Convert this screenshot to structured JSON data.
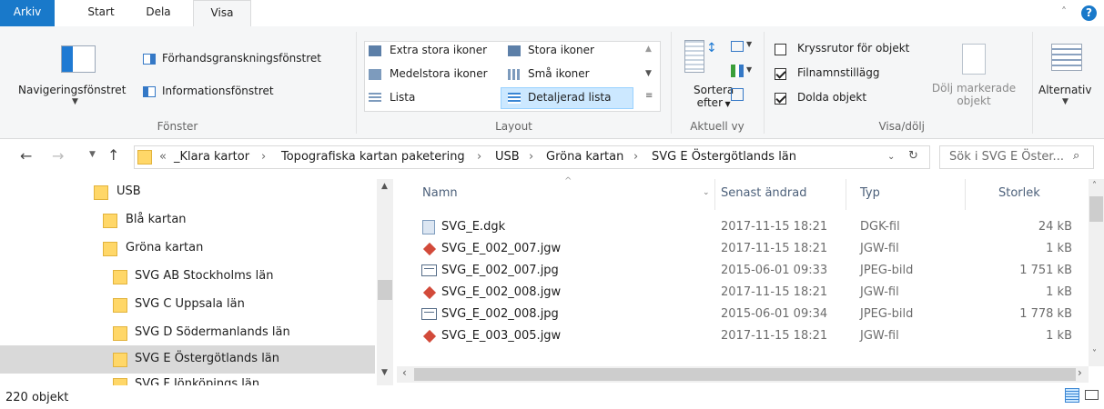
{
  "tabs": {
    "file": "Arkiv",
    "home": "Start",
    "share": "Dela",
    "view": "Visa"
  },
  "ribbon": {
    "panes": {
      "preview": "Förhandsgranskningsfönstret",
      "navigation": "Navigeringsfönstret",
      "details": "Informationsfönstret",
      "group": "Fönster"
    },
    "layout": {
      "extra_large": "Extra stora ikoner",
      "large": "Stora ikoner",
      "medium": "Medelstora ikoner",
      "small": "Små ikoner",
      "list": "Lista",
      "details": "Detaljerad lista",
      "group": "Layout"
    },
    "current_view": {
      "sort_line1": "Sortera",
      "sort_line2": "efter",
      "group": "Aktuell vy"
    },
    "show_hide": {
      "item_checkboxes": "Kryssrutor för objekt",
      "file_extensions": "Filnamnstillägg",
      "hidden_items": "Dolda objekt",
      "hide_selected_line1": "Dölj markerade",
      "hide_selected_line2": "objekt",
      "group": "Visa/dölj"
    },
    "options": "Alternativ"
  },
  "address": {
    "prefix": "«",
    "crumbs": [
      "_Klara kartor",
      "Topografiska kartan paketering",
      "USB",
      "Gröna kartan",
      "SVG E Östergötlands län"
    ],
    "search_placeholder": "Sök i SVG E Öster..."
  },
  "nav": [
    {
      "label": "USB"
    },
    {
      "label": "Blå kartan"
    },
    {
      "label": "Gröna kartan"
    },
    {
      "label": "SVG AB Stockholms län"
    },
    {
      "label": "SVG C Uppsala län"
    },
    {
      "label": "SVG D Södermanlands län"
    },
    {
      "label": "SVG E Östergötlands län"
    },
    {
      "label": "SVG F Jönköpings län"
    }
  ],
  "columns": {
    "name": "Namn",
    "date": "Senast ändrad",
    "type": "Typ",
    "size": "Storlek"
  },
  "files": [
    {
      "name": "SVG_E.dgk",
      "date": "2017-11-15 18:21",
      "type": "DGK-fil",
      "size": "24 kB"
    },
    {
      "name": "SVG_E_002_007.jgw",
      "date": "2017-11-15 18:21",
      "type": "JGW-fil",
      "size": "1 kB"
    },
    {
      "name": "SVG_E_002_007.jpg",
      "date": "2015-06-01 09:33",
      "type": "JPEG-bild",
      "size": "1 751 kB"
    },
    {
      "name": "SVG_E_002_008.jgw",
      "date": "2017-11-15 18:21",
      "type": "JGW-fil",
      "size": "1 kB"
    },
    {
      "name": "SVG_E_002_008.jpg",
      "date": "2015-06-01 09:34",
      "type": "JPEG-bild",
      "size": "1 778 kB"
    },
    {
      "name": "SVG_E_003_005.jgw",
      "date": "2017-11-15 18:21",
      "type": "JGW-fil",
      "size": "1 kB"
    }
  ],
  "status": {
    "count": "220 objekt"
  }
}
